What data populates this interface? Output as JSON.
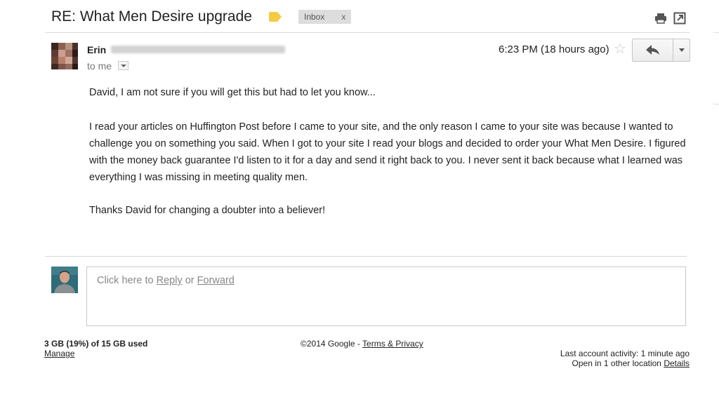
{
  "email": {
    "subject": "RE: What Men Desire upgrade",
    "label": "Inbox",
    "label_remove": "x",
    "sender_name": "Erin",
    "recipient": "to me",
    "timestamp": "6:23 PM (18 hours ago)",
    "body": [
      "David, I am not sure if you will get this but had to let you know...",
      "I read your articles on Huffington Post before I came to your site, and the only reason I came to your site was because I wanted to challenge you on something you said. When I got to your site I read your blogs and decided to order your What Men Desire. I figured with the money back guarantee I'd listen to it for a day and send it right back to you. I never sent it back because what I learned was everything I was missing in meeting quality men.",
      "Thanks David for changing a doubter into a believer!"
    ]
  },
  "icons": {
    "label_tag": "label-tag-icon",
    "print": "print-icon",
    "new_window": "new-window-icon",
    "star": "star-icon",
    "reply": "reply-arrow-icon",
    "more": "dropdown-arrow-icon"
  },
  "reply_box": {
    "prefix": "Click here to",
    "reply_link": "Reply",
    "or_text": "or",
    "forward_link": "Forward"
  },
  "footer": {
    "storage": "3 GB (19%) of 15 GB used",
    "manage": "Manage",
    "copyright": "©2014 Google -",
    "terms": "Terms & Privacy",
    "last_activity": "Last account activity: 1 minute ago",
    "open_elsewhere": "Open in 1 other location",
    "details": "Details"
  },
  "colors": {
    "label_tag": "#f3cc44",
    "inbox_chip_bg": "#dddddd",
    "divider": "#d8d8d8"
  }
}
